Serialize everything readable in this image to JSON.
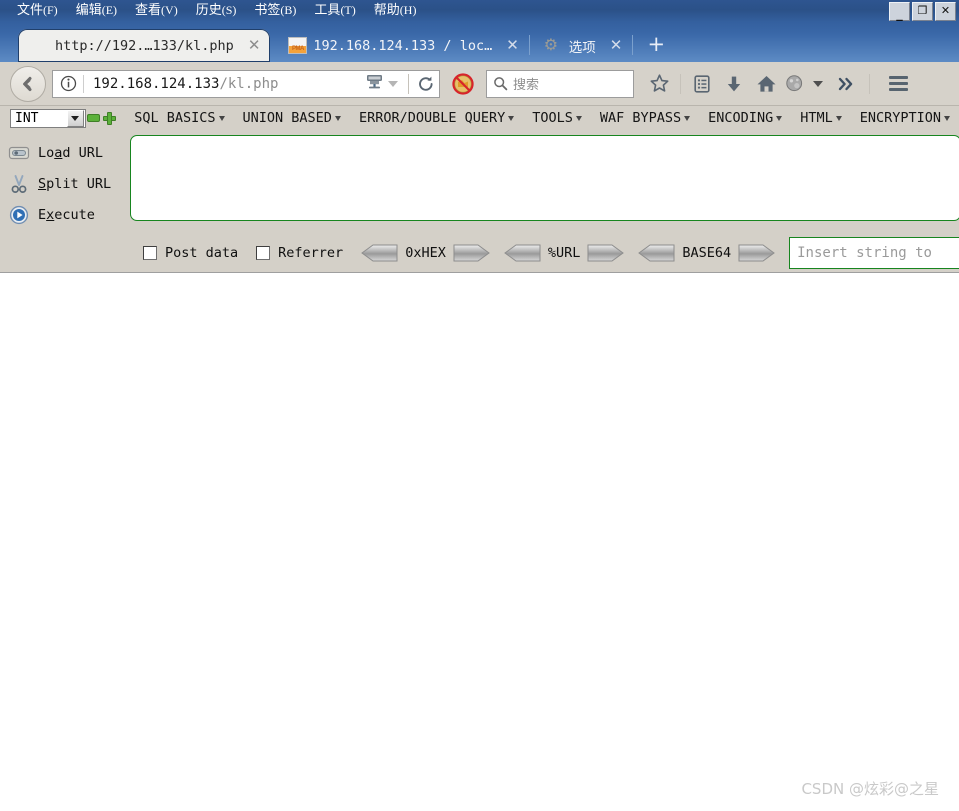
{
  "window": {
    "menu": [
      {
        "label": "文件",
        "accel": "(F)"
      },
      {
        "label": "编辑",
        "accel": "(E)"
      },
      {
        "label": "查看",
        "accel": "(V)"
      },
      {
        "label": "历史",
        "accel": "(S)"
      },
      {
        "label": "书签",
        "accel": "(B)"
      },
      {
        "label": "工具",
        "accel": "(T)"
      },
      {
        "label": "帮助",
        "accel": "(H)"
      }
    ],
    "controls": {
      "minimize": "_",
      "restore": "❐",
      "close": "✕"
    }
  },
  "tabs": [
    {
      "title": "http://192.…133/kl.php",
      "favicon": "hex-icon",
      "active": true,
      "close": "✕"
    },
    {
      "title": "192.168.124.133 / loc…",
      "favicon": "phpmyadmin-icon",
      "active": false,
      "close": "✕"
    },
    {
      "title": "选项",
      "favicon": "gear-icon",
      "active": false,
      "close": "✕"
    }
  ],
  "newtab_label": "+",
  "navbar": {
    "back_icon": "back-arrow-icon",
    "identity_icon": "info-icon",
    "url_main": "192.168.124.133",
    "url_path": "/kl.php",
    "reader_icon": "server-icon",
    "reload_icon": "reload-icon",
    "noscript_icon": "noscript-blocked-icon",
    "search_placeholder": "搜索",
    "search_icon": "search-icon",
    "icons": [
      {
        "name": "bookmark-star-icon"
      },
      {
        "name": "library-icon"
      },
      {
        "name": "downloads-icon"
      },
      {
        "name": "home-icon"
      },
      {
        "name": "account-icon"
      },
      {
        "name": "overflow-chevrons-icon"
      }
    ],
    "menu_icon": "hamburger-menu-icon"
  },
  "hackbar": {
    "type_select": {
      "value": "INT"
    },
    "remove_icon": "minus-icon",
    "add_icon": "plus-icon",
    "menus": [
      {
        "label": "SQL BASICS"
      },
      {
        "label": "UNION BASED"
      },
      {
        "label": "ERROR/DOUBLE QUERY"
      },
      {
        "label": "TOOLS"
      },
      {
        "label": "WAF BYPASS"
      },
      {
        "label": "ENCODING"
      },
      {
        "label": "HTML"
      },
      {
        "label": "ENCRYPTION"
      }
    ],
    "actions": [
      {
        "icon": "load-url-icon",
        "pre": "Lo",
        "key": "a",
        "post": "d URL"
      },
      {
        "icon": "split-url-icon",
        "pre": "",
        "key": "S",
        "post": "plit URL"
      },
      {
        "icon": "execute-icon",
        "pre": "E",
        "key": "x",
        "post": "ecute"
      }
    ],
    "url_textarea_value": "",
    "checkboxes": [
      {
        "label": "Post data",
        "checked": false
      },
      {
        "label": "Referrer",
        "checked": false
      }
    ],
    "codecs": [
      {
        "name": "0xHEX"
      },
      {
        "name": "%URL"
      },
      {
        "name": "BASE64"
      }
    ],
    "string_input": {
      "value": "",
      "placeholder": "Insert string to"
    }
  },
  "page": {
    "body_text": "",
    "watermark": "CSDN @炫彩@之星"
  },
  "colors": {
    "title_bar": "#2e5590",
    "tab_strip": "#3a68a8",
    "toolbar": "#d6d2ca",
    "hackbar_bg": "#d4d0c8",
    "hackbar_border": "#17851f",
    "accent_green": "#5cb13a"
  }
}
